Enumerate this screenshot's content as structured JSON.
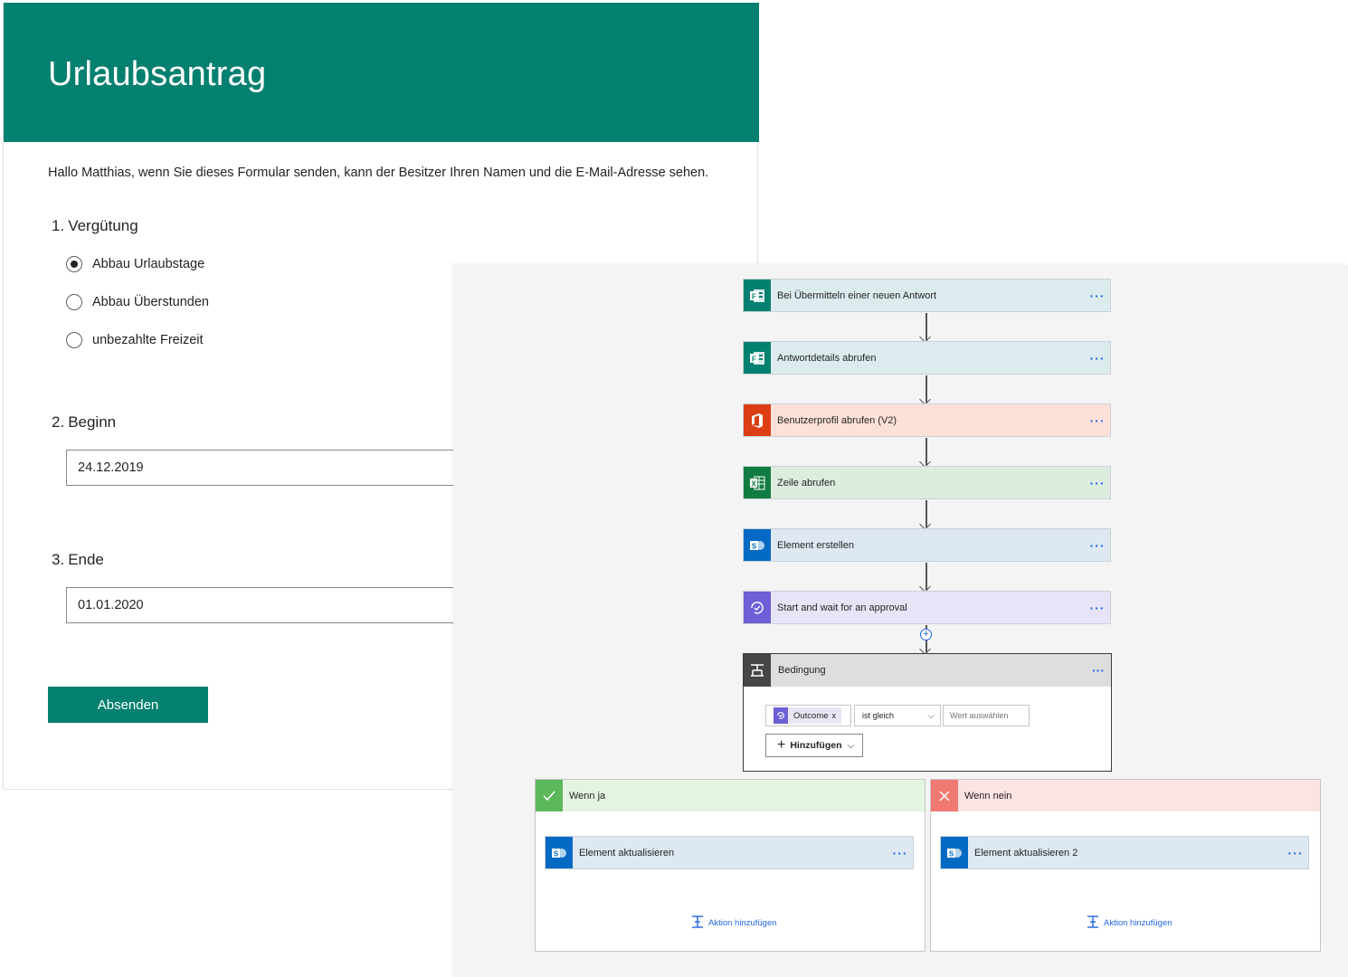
{
  "form": {
    "title": "Urlaubsantrag",
    "intro": "Hallo Matthias, wenn Sie dieses Formular senden, kann der Besitzer Ihren Namen und die E-Mail-Adresse sehen.",
    "q1": {
      "number": "1.",
      "title": "Vergütung",
      "options": [
        "Abbau Urlaubstage",
        "Abbau Überstunden",
        "unbezahlte Freizeit"
      ],
      "selected": "Abbau Urlaubstage"
    },
    "q2": {
      "number": "2.",
      "title": "Beginn",
      "value": "24.12.2019"
    },
    "q3": {
      "number": "3.",
      "title": "Ende",
      "value": "01.01.2020"
    },
    "submit_label": "Absenden",
    "accent_color": "#03806f"
  },
  "flow": {
    "steps": [
      {
        "label": "Bei Übermitteln einer neuen Antwort",
        "icon": "forms-icon",
        "color": "#dbebee",
        "icon_color": "#03806f"
      },
      {
        "label": "Antwortdetails abrufen",
        "icon": "forms-icon",
        "color": "#dbebee",
        "icon_color": "#03806f"
      },
      {
        "label": "Benutzerprofil abrufen (V2)",
        "icon": "office-icon",
        "color": "#fde1d9",
        "icon_color": "#dc3e15"
      },
      {
        "label": "Zeile abrufen",
        "icon": "excel-icon",
        "color": "#dcecdf",
        "icon_color": "#107c41"
      },
      {
        "label": "Element erstellen",
        "icon": "sharepoint-icon",
        "color": "#dde8f3",
        "icon_color": "#036ac4"
      },
      {
        "label": "Start and wait for an approval",
        "icon": "approval-icon",
        "color": "#e7e4f7",
        "icon_color": "#6d5fd6"
      }
    ],
    "more_glyph": "···",
    "condition": {
      "label": "Bedingung",
      "token": "Outcome",
      "token_remove": "x",
      "operator": "ist gleich",
      "value_placeholder": "Wert auswählen",
      "add_label": "Hinzufügen"
    },
    "branch_yes": {
      "label": "Wenn ja",
      "color": "#e3f4e0",
      "icon_color": "#5cb85c",
      "step_label": "Element aktualisieren",
      "add_action": "Aktion hinzufügen"
    },
    "branch_no": {
      "label": "Wenn nein",
      "color": "#fde3e3",
      "icon_color": "#f07a72",
      "step_label": "Element aktualisieren 2",
      "add_action": "Aktion hinzufügen"
    }
  }
}
